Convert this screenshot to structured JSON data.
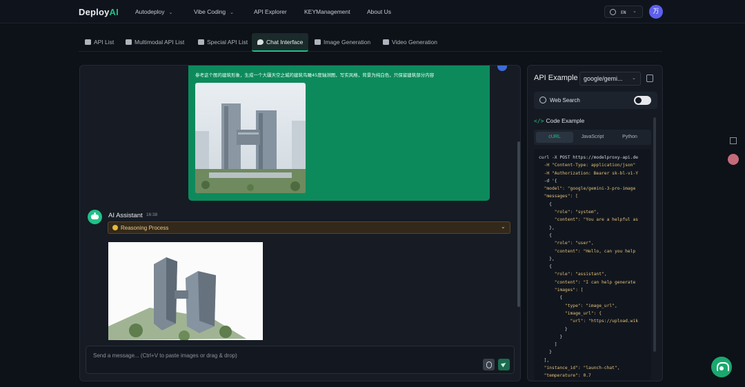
{
  "nav": {
    "logo_main": "Deploy",
    "logo_accent": "AI",
    "items": [
      {
        "label": "Autodeploy",
        "dropdown": true
      },
      {
        "label": "Vibe Coding",
        "dropdown": true
      },
      {
        "label": "API Explorer",
        "dropdown": false
      },
      {
        "label": "KEYManagement",
        "dropdown": false
      },
      {
        "label": "About Us",
        "dropdown": false
      }
    ],
    "lang": "EN",
    "avatar_initial": "万",
    "icons": [
      "globe-icon",
      "chevron-down-icon"
    ]
  },
  "tabs": [
    {
      "label": "API List",
      "icon": "list-icon",
      "active": false
    },
    {
      "label": "Multimodal API List",
      "icon": "multimodal-icon",
      "active": false
    },
    {
      "label": "Special API List",
      "icon": "tag-icon",
      "active": false
    },
    {
      "label": "Chat Interface",
      "icon": "chat-icon",
      "active": true
    },
    {
      "label": "Image Generation",
      "icon": "image-icon",
      "active": false
    },
    {
      "label": "Video Generation",
      "icon": "video-icon",
      "active": false
    }
  ],
  "chat": {
    "user_message": "参考这个图的建筑形象，生成一个大疆天空之城的建筑鸟瞰45度轴测图，写实风格，背景为纯白色，只保留建筑部分内容",
    "assistant_name": "AI Assistant",
    "assistant_time": "16:38",
    "reasoning_label": "Reasoning Process",
    "input_placeholder": "Send a message... (Ctrl+V to paste images or drag & drop)"
  },
  "api": {
    "title": "API Example",
    "model": "google/gemi...",
    "web_search_label": "Web Search",
    "web_search_enabled": false,
    "code_heading": "Code Example",
    "code_tabs": [
      {
        "label": "cURL",
        "active": true
      },
      {
        "label": "JavaScript",
        "active": false
      },
      {
        "label": "Python",
        "active": false
      }
    ],
    "code_lines": [
      {
        "t": "curl -X POST https://modelproxy-api.de",
        "s": false
      },
      {
        "t": "  -H \"Content-Type: application/json\"",
        "s": true
      },
      {
        "t": "  -H \"Authorization: Bearer sk-bl-v1-Y",
        "s": true
      },
      {
        "t": "  -d '{",
        "s": false
      },
      {
        "t": "  \"model\": \"google/gemini-3-pro-image",
        "s": true
      },
      {
        "t": "  \"messages\": [",
        "s": true
      },
      {
        "t": "    {",
        "s": false
      },
      {
        "t": "      \"role\": \"system\",",
        "s": true
      },
      {
        "t": "      \"content\": \"You are a helpful as",
        "s": true
      },
      {
        "t": "    },",
        "s": false
      },
      {
        "t": "    {",
        "s": false
      },
      {
        "t": "      \"role\": \"user\",",
        "s": true
      },
      {
        "t": "      \"content\": \"Hello, can you help",
        "s": true
      },
      {
        "t": "    },",
        "s": false
      },
      {
        "t": "    {",
        "s": false
      },
      {
        "t": "      \"role\": \"assistant\",",
        "s": true
      },
      {
        "t": "      \"content\": \"I can help generate",
        "s": true
      },
      {
        "t": "      \"images\": [",
        "s": true
      },
      {
        "t": "        {",
        "s": false
      },
      {
        "t": "          \"type\": \"image_url\",",
        "s": true
      },
      {
        "t": "          \"image_url\": {",
        "s": true
      },
      {
        "t": "            \"url\": \"https://upload.wik",
        "s": true
      },
      {
        "t": "          }",
        "s": false
      },
      {
        "t": "        }",
        "s": false
      },
      {
        "t": "      ]",
        "s": false
      },
      {
        "t": "    }",
        "s": false
      },
      {
        "t": "  ],",
        "s": false
      },
      {
        "t": "  \"instance_id\": \"launch-chat\",",
        "s": true
      },
      {
        "t": "  \"temperature\": 0.7",
        "s": true
      }
    ]
  }
}
